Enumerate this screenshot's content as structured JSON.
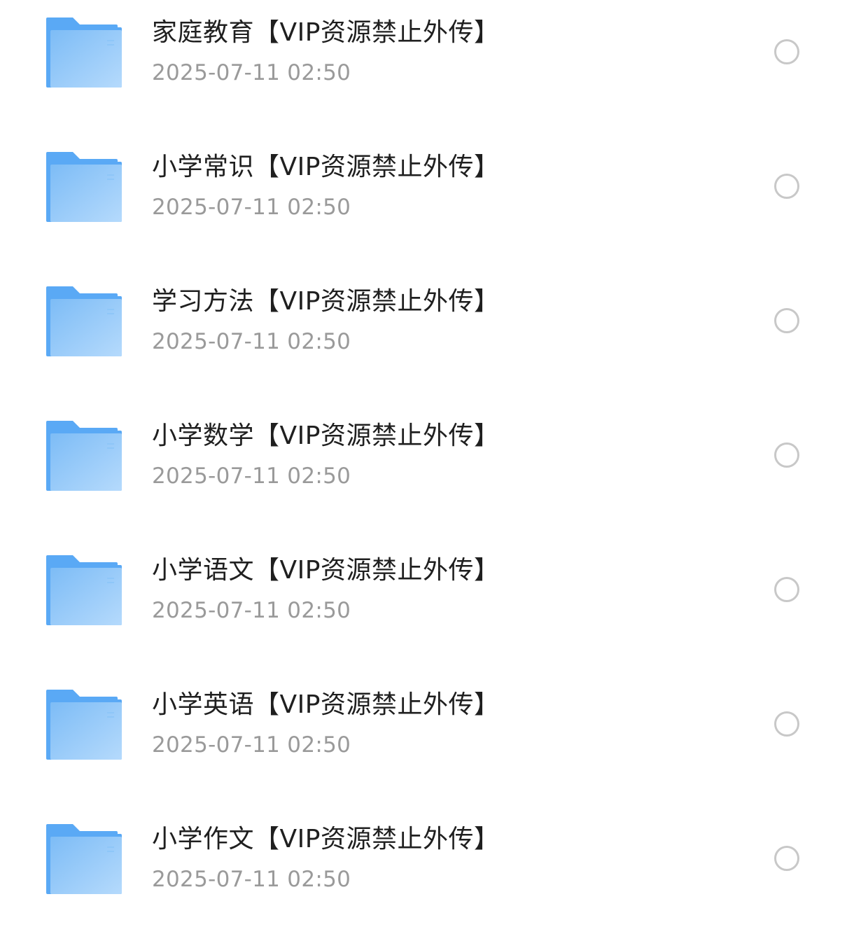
{
  "files": [
    {
      "name": "家庭教育【VIP资源禁止外传】",
      "time": "2025-07-11 02:50",
      "icon": "folder-icon"
    },
    {
      "name": "小学常识【VIP资源禁止外传】",
      "time": "2025-07-11 02:50",
      "icon": "folder-icon"
    },
    {
      "name": "学习方法【VIP资源禁止外传】",
      "time": "2025-07-11 02:50",
      "icon": "folder-icon"
    },
    {
      "name": "小学数学【VIP资源禁止外传】",
      "time": "2025-07-11 02:50",
      "icon": "folder-icon"
    },
    {
      "name": "小学语文【VIP资源禁止外传】",
      "time": "2025-07-11 02:50",
      "icon": "folder-icon"
    },
    {
      "name": "小学英语【VIP资源禁止外传】",
      "time": "2025-07-11 02:50",
      "icon": "folder-icon"
    },
    {
      "name": "小学作文【VIP资源禁止外传】",
      "time": "2025-07-11 02:50",
      "icon": "folder-icon"
    }
  ],
  "colors": {
    "folder_back": "#5aa9f5",
    "folder_front_start": "#7dbcf6",
    "folder_front_end": "#b5dafc",
    "text_primary": "#1f1f1f",
    "text_secondary": "#9a9a9a",
    "radio_border": "#c8c8c8"
  }
}
